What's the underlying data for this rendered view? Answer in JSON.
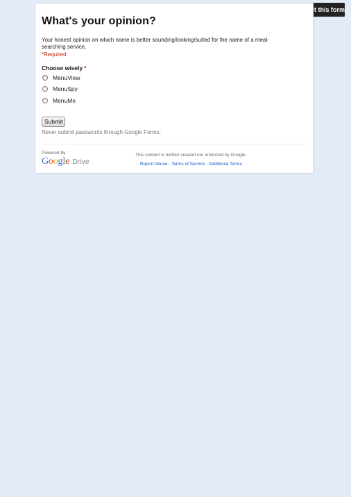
{
  "edit_button": {
    "label": "Edit this form",
    "icon": "pencil-icon"
  },
  "form": {
    "title": "What's your opinion?",
    "description": "Your honest opinion on which name is better sounding/looking/suited for the name of a meal-searching service.",
    "required_note": "*Required",
    "question": {
      "title": "Choose wisely",
      "required_mark": "*",
      "options": [
        "MenuView",
        "MenuSpy",
        "MenuMe"
      ]
    },
    "submit_label": "Submit",
    "password_warning": "Never submit passwords through Google Forms."
  },
  "footer": {
    "powered_by": "Powered by",
    "logo_google": "Google",
    "logo_drive": "Drive",
    "disclaimer": "This content is neither created nor endorsed by Google.",
    "links": [
      "Report Abuse",
      "Terms of Service",
      "Additional Terms"
    ],
    "separator": " - "
  },
  "colors": {
    "page_background": "#e3ebf6",
    "required_red": "#c4290b",
    "link_blue": "#1155cc",
    "edit_button_bg": "#222222"
  }
}
